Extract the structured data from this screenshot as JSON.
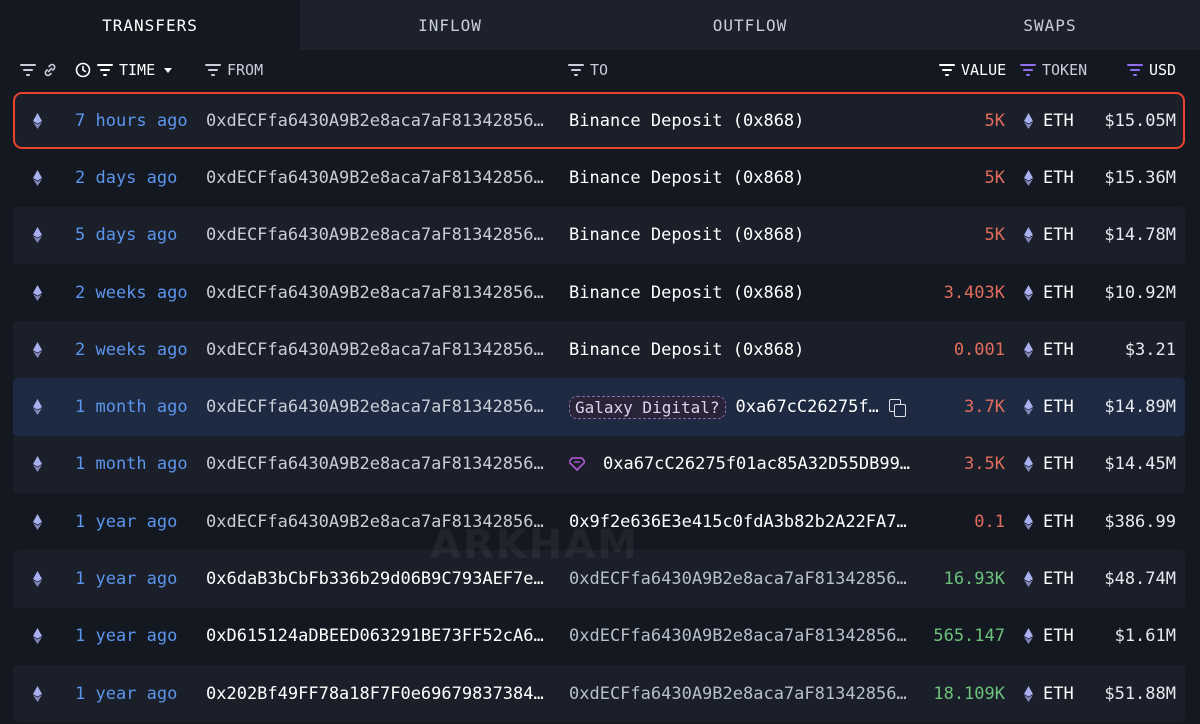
{
  "tabs": [
    {
      "label": "TRANSFERS",
      "active": true
    },
    {
      "label": "INFLOW",
      "active": false
    },
    {
      "label": "OUTFLOW",
      "active": false
    },
    {
      "label": "SWAPS",
      "active": false
    }
  ],
  "columns": {
    "time": "TIME",
    "from": "FROM",
    "to": "TO",
    "value": "VALUE",
    "token": "TOKEN",
    "usd": "USD"
  },
  "colors": {
    "time": "#5b95ec",
    "value_out": "#e36d5c",
    "value_in": "#6cc27b",
    "selected_outline": "#e8432d",
    "filter_accent": "#8f6ef0"
  },
  "watermark": "ARKHAM",
  "rows": [
    {
      "time": "7 hours ago",
      "from": "0xdECFfa6430A9B2e8aca7aF81342856…",
      "to": "Binance Deposit (0x868)",
      "value": "5K",
      "token": "ETH",
      "usd": "$15.05M"
    },
    {
      "time": "2 days ago",
      "from": "0xdECFfa6430A9B2e8aca7aF81342856…",
      "to": "Binance Deposit (0x868)",
      "value": "5K",
      "token": "ETH",
      "usd": "$15.36M"
    },
    {
      "time": "5 days ago",
      "from": "0xdECFfa6430A9B2e8aca7aF81342856…",
      "to": "Binance Deposit (0x868)",
      "value": "5K",
      "token": "ETH",
      "usd": "$14.78M"
    },
    {
      "time": "2 weeks ago",
      "from": "0xdECFfa6430A9B2e8aca7aF81342856…",
      "to": "Binance Deposit (0x868)",
      "value": "3.403K",
      "token": "ETH",
      "usd": "$10.92M"
    },
    {
      "time": "2 weeks ago",
      "from": "0xdECFfa6430A9B2e8aca7aF81342856…",
      "to": "Binance Deposit (0x868)",
      "value": "0.001",
      "token": "ETH",
      "usd": "$3.21"
    },
    {
      "time": "1 month ago",
      "from": "0xdECFfa6430A9B2e8aca7aF81342856…",
      "to_tag": "Galaxy Digital?",
      "to": "0xa67cC26275f…",
      "value": "3.7K",
      "token": "ETH",
      "usd": "$14.89M"
    },
    {
      "time": "1 month ago",
      "from": "0xdECFfa6430A9B2e8aca7aF81342856…",
      "to": "0xa67cC26275f01ac85A32D55DB99…",
      "value": "3.5K",
      "token": "ETH",
      "usd": "$14.45M"
    },
    {
      "time": "1 year ago",
      "from": "0xdECFfa6430A9B2e8aca7aF81342856…",
      "to": "0x9f2e636E3e415c0fdA3b82b2A22FA7…",
      "value": "0.1",
      "token": "ETH",
      "usd": "$386.99"
    },
    {
      "time": "1 year ago",
      "from": "0x6daB3bCbFb336b29d06B9C793AEF7e…",
      "to": "0xdECFfa6430A9B2e8aca7aF81342856…",
      "value": "16.93K",
      "token": "ETH",
      "usd": "$48.74M"
    },
    {
      "time": "1 year ago",
      "from": "0xD615124aDBEED063291BE73FF52cA6…",
      "to": "0xdECFfa6430A9B2e8aca7aF81342856…",
      "value": "565.147",
      "token": "ETH",
      "usd": "$1.61M"
    },
    {
      "time": "1 year ago",
      "from": "0x202Bf49FF78a18F7F0e69679837384…",
      "to": "0xdECFfa6430A9B2e8aca7aF81342856…",
      "value": "18.109K",
      "token": "ETH",
      "usd": "$51.88M"
    }
  ]
}
